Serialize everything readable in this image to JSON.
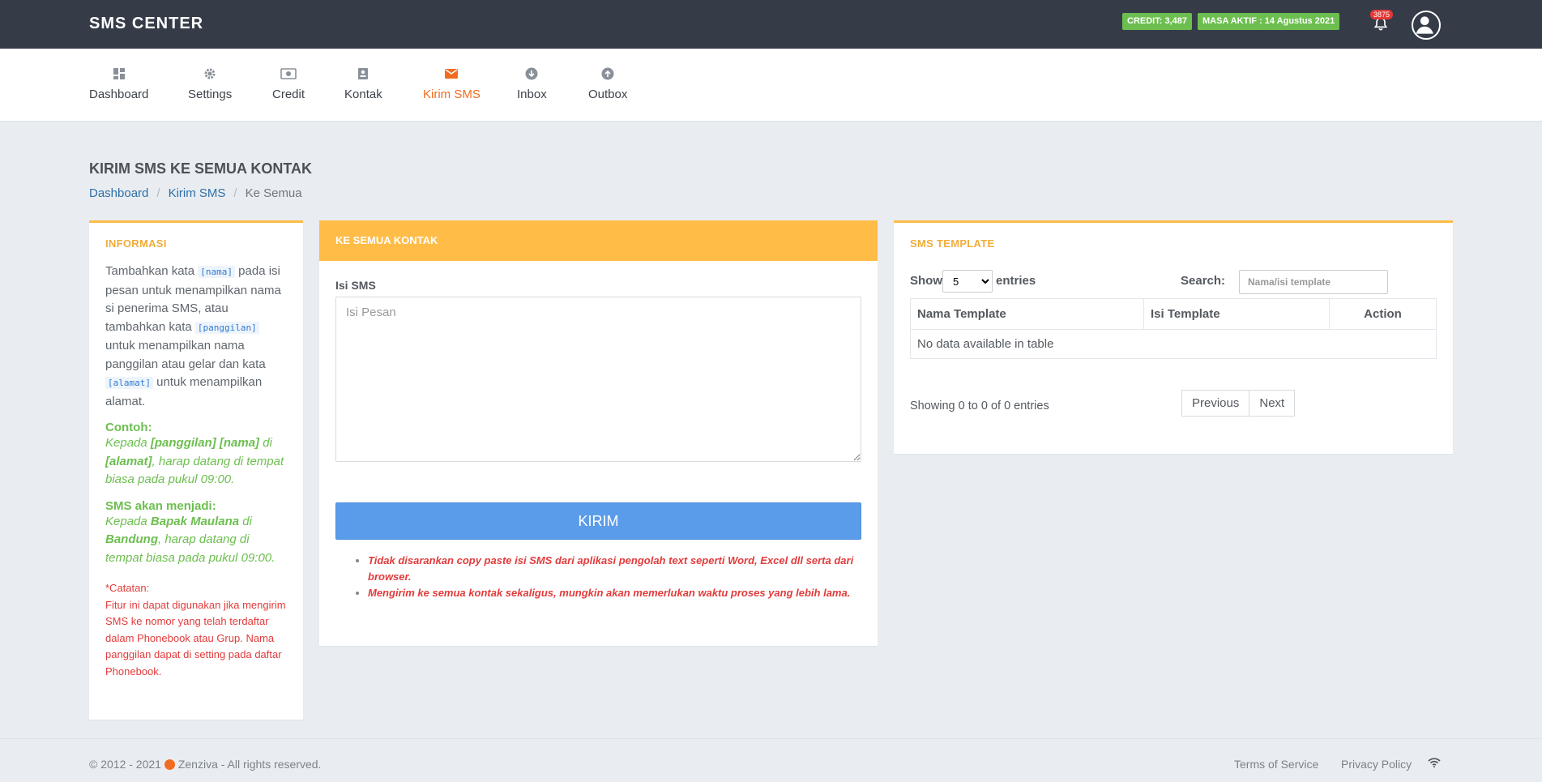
{
  "topbar": {
    "brand": "SMS CENTER",
    "credit": "CREDIT: 3,487",
    "masa_aktif": "MASA AKTIF : 14 Agustus 2021",
    "notif_count": "3875"
  },
  "nav": {
    "items": [
      {
        "label": "Dashboard",
        "icon": "dashboard-icon"
      },
      {
        "label": "Settings",
        "icon": "gear-icon"
      },
      {
        "label": "Credit",
        "icon": "money-icon"
      },
      {
        "label": "Kontak",
        "icon": "contact-icon"
      },
      {
        "label": "Kirim SMS",
        "icon": "envelope-icon"
      },
      {
        "label": "Inbox",
        "icon": "download-icon"
      },
      {
        "label": "Outbox",
        "icon": "upload-icon"
      }
    ],
    "active": "Kirim SMS"
  },
  "page": {
    "title": "KIRIM SMS KE SEMUA KONTAK",
    "breadcrumb": [
      "Dashboard",
      "Kirim SMS",
      "Ke Semua"
    ]
  },
  "info": {
    "title": "INFORMASI",
    "p1a": "Tambahkan kata ",
    "tag_nama": "[nama]",
    "p1b": " pada isi pesan untuk menampilkan nama si penerima SMS, atau tambahkan kata ",
    "tag_panggilan": "[panggilan]",
    "p1c": " untuk menampilkan nama panggilan atau gelar dan kata ",
    "tag_alamat": "[alamat]",
    "p1d": " untuk menampilkan alamat.",
    "contoh_label": "Contoh:",
    "contoh_a": "Kepada ",
    "contoh_b": "[panggilan] [nama]",
    "contoh_c": " di ",
    "contoh_d": "[alamat]",
    "contoh_e": ", harap datang di tempat biasa pada pukul 09:00.",
    "hasil_label": "SMS akan menjadi:",
    "hasil_a": "Kepada ",
    "hasil_b": "Bapak Maulana",
    "hasil_c": " di ",
    "hasil_d": "Bandung",
    "hasil_e": ", harap datang di tempat biasa pada pukul 09:00.",
    "note_label": "*Catatan:",
    "note_text": "Fitur ini dapat digunakan jika mengirim SMS ke nomor yang telah terdaftar dalam Phonebook atau Grup. Nama panggilan dapat di setting pada daftar Phonebook."
  },
  "compose": {
    "header": "KE SEMUA KONTAK",
    "label": "Isi SMS",
    "placeholder": "Isi Pesan",
    "value": "",
    "button": "KIRIM",
    "warnings": [
      "Tidak disarankan copy paste isi SMS dari aplikasi pengolah text seperti Word, Excel dll serta dari browser.",
      "Mengirim ke semua kontak sekaligus, mungkin akan memerlukan waktu proses yang lebih lama."
    ]
  },
  "template": {
    "title": "SMS TEMPLATE",
    "show": "Show",
    "entries": "entries",
    "page_size": "5",
    "search_label": "Search:",
    "search_placeholder": "Nama/isi template",
    "columns": [
      "Nama Template",
      "Isi Template",
      "Action"
    ],
    "empty": "No data available in table",
    "summary": "Showing 0 to 0 of 0 entries",
    "prev": "Previous",
    "next": "Next"
  },
  "footer": {
    "copyright": "© 2012 - 2021",
    "brand": "Zenziva - All rights reserved.",
    "terms": "Terms of Service",
    "privacy": "Privacy Policy"
  },
  "colors": {
    "topbar": "#353c48",
    "accent": "#ffbc47",
    "active_nav": "#f16c20",
    "green": "#6cbf4f",
    "danger": "#e23b3b",
    "primary_button": "#5b9cea"
  }
}
